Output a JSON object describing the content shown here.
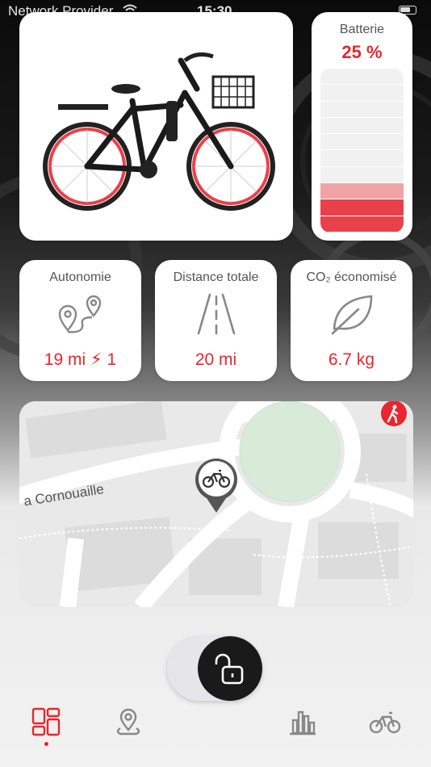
{
  "status_bar": {
    "carrier": "Network Provider",
    "time": "15:30"
  },
  "battery": {
    "label": "Batterie",
    "value": "25 %",
    "level_fraction": 0.25,
    "segments": 10
  },
  "stats": [
    {
      "label": "Autonomie",
      "value": "19 mi ⚡ 1",
      "icon": "route-pins-icon"
    },
    {
      "label": "Distance totale",
      "value": "20 mi",
      "icon": "road-icon"
    },
    {
      "label": "CO₂ économisé",
      "value": "6.7 kg",
      "icon": "leaf-icon"
    }
  ],
  "map": {
    "street_label": "a Cornouaille",
    "marker_icon": "bike-location-pin-icon",
    "badge_icon": "pedestrian-icon"
  },
  "lock": {
    "state": "unlocked",
    "icon": "padlock-open-icon"
  },
  "tabs": [
    "dashboard-icon",
    "location-icon",
    "stats-icon",
    "bike-icon"
  ],
  "colors": {
    "accent": "#e8262d",
    "knob": "#1a1a1a"
  }
}
